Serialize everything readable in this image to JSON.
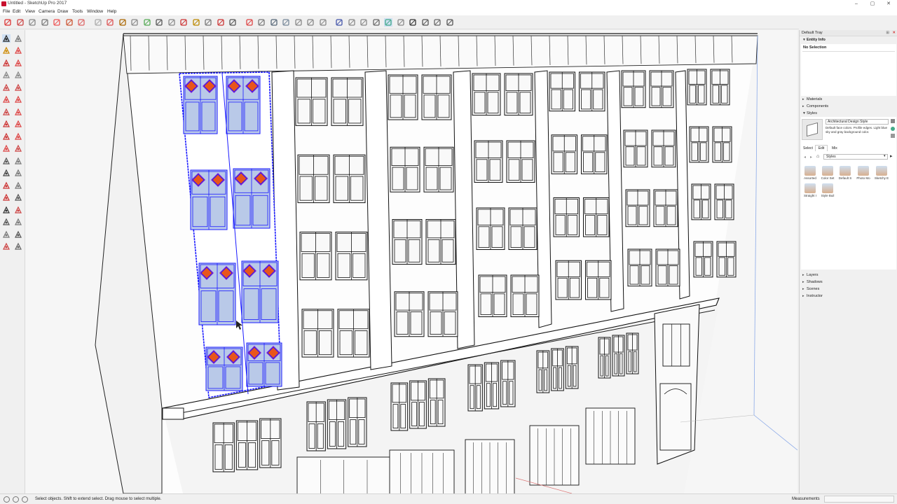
{
  "window": {
    "title": "Untitled - SketchUp Pro 2017",
    "controls": [
      "–",
      "▢",
      "✕"
    ]
  },
  "menu": [
    "File",
    "Edit",
    "View",
    "Camera",
    "Draw",
    "Tools",
    "Window",
    "Help"
  ],
  "tray": {
    "title": "Default Tray",
    "entity_info": {
      "header": "Entity Info",
      "selection": "No Selection"
    },
    "sections": [
      "Materials",
      "Components",
      "Styles"
    ],
    "styles": {
      "style_name": "Architectural Design Style",
      "style_description": "Default face colors. Profile edges. Light blue sky and gray background color.",
      "tabs": [
        "Select",
        "Edit",
        "Mix"
      ],
      "collection": "Styles",
      "thumbnails": [
        "Assorted",
        "Color Set",
        "Default S",
        "Photo Mo",
        "Sketchy E",
        "Straight I",
        "Style Buil"
      ]
    },
    "collapsed_panels": [
      "Layers",
      "Shadows",
      "Scenes",
      "Instructor"
    ]
  },
  "status": {
    "text": "Select objects. Shift to extend select. Drag mouse to select multiple.",
    "measurements_label": "Measurements",
    "measurements_value": ""
  },
  "colors": {
    "selection": "#1a1aff",
    "diamond": "#e8551c",
    "glass_selected": "#b9c9e8",
    "ui_bg": "#f0f0f0"
  },
  "toolbar_icons": [
    "select-icon",
    "eraser-icon",
    "paint-icon",
    "rectangle-icon",
    "push-pull-icon",
    "move-icon",
    "rotate-icon",
    "scale-icon",
    "offset-icon",
    "tape-icon",
    "dimension-icon",
    "protractor-icon",
    "text-icon",
    "axes-icon",
    "orbit-icon",
    "pan-icon",
    "zoom-icon",
    "zoom-window-icon",
    "zoom-extents-icon",
    "section-plane-icon",
    "iso-view-icon",
    "top-view-icon",
    "front-view-icon",
    "right-view-icon",
    "back-view-icon",
    "left-view-icon",
    "xray-icon",
    "backedges-icon",
    "wireframe-icon",
    "hidden-line-icon",
    "shaded-icon",
    "textured-icon",
    "monochrome-icon",
    "warehouse-icon",
    "extension-icon",
    "share-icon"
  ]
}
